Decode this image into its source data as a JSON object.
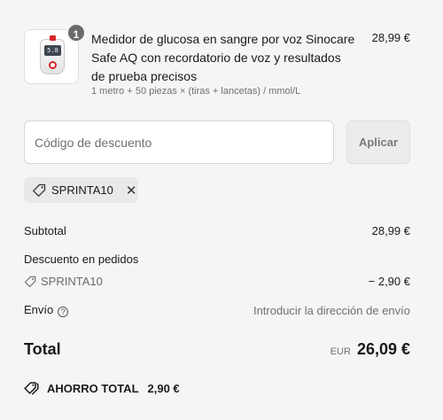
{
  "product": {
    "quantity": "1",
    "title": "Medidor de glucosa en sangre por voz Sinocare Safe AQ con recordatorio de voz y resultados de prueba precisos",
    "variant": "1 metro + 50 piezas × (tiras + lancetas) / mmol/L",
    "price": "28,99 €",
    "image_screen_text": "5.8"
  },
  "discount": {
    "placeholder": "Código de descuento",
    "apply_label": "Aplicar",
    "applied_code": "SPRINTA10"
  },
  "summary": {
    "subtotal_label": "Subtotal",
    "subtotal_value": "28,99 €",
    "order_discount_label": "Descuento en pedidos",
    "discount_code": "SPRINTA10",
    "discount_value": "− 2,90 €",
    "shipping_label": "Envío",
    "shipping_value": "Introducir la dirección de envío",
    "total_label": "Total",
    "currency": "EUR",
    "total_value": "26,09 €",
    "savings_label": "AHORRO TOTAL",
    "savings_value": "2,90 €"
  },
  "icons": {
    "tag": "tag-icon",
    "remove": "close-icon",
    "help": "question-circle-icon",
    "savings": "tags-icon"
  }
}
